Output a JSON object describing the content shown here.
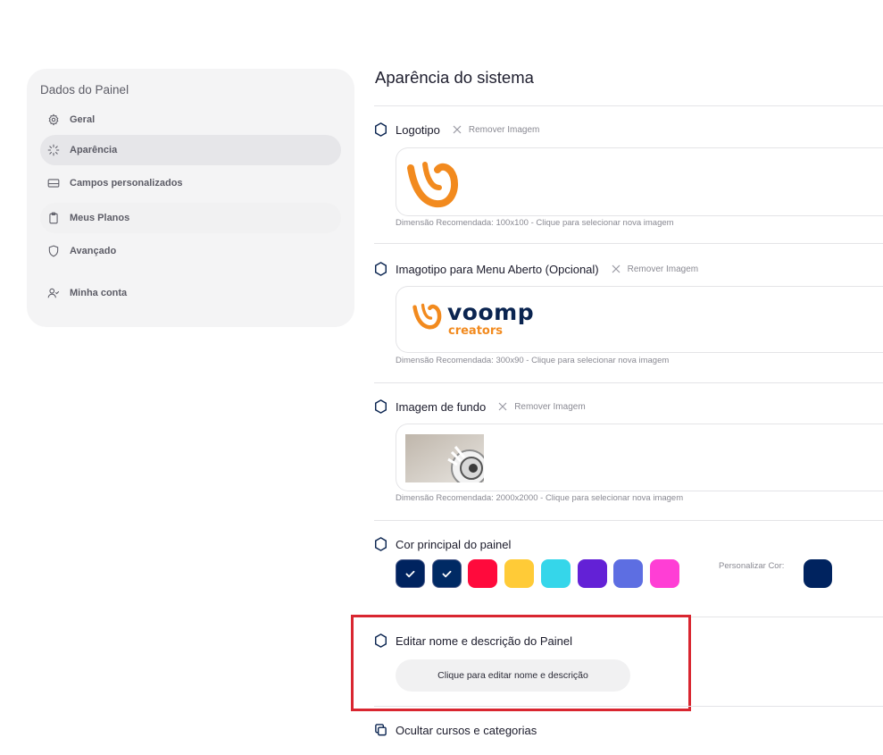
{
  "sidebar": {
    "title": "Dados do Painel",
    "items": [
      {
        "label": "Geral",
        "icon": "gear-icon"
      },
      {
        "label": "Aparência",
        "icon": "loader-icon"
      },
      {
        "label": "Campos personalizados",
        "icon": "card-icon"
      },
      {
        "label": "Meus Planos",
        "icon": "clipboard-icon"
      },
      {
        "label": "Avançado",
        "icon": "shield-icon"
      },
      {
        "label": "Minha conta",
        "icon": "user-check-icon"
      }
    ]
  },
  "main": {
    "title": "Aparência do sistema",
    "remove_label": "Remover Imagem",
    "sections": {
      "logo": {
        "title": "Logotipo",
        "hint": "Dimensão Recomendada: 100x100 - Clique para selecionar nova imagem"
      },
      "imagotipo": {
        "title": "Imagotipo para Menu Aberto (Opcional)",
        "hint": "Dimensão Recomendada: 300x90 - Clique para selecionar nova imagem",
        "brand_word": "voomp",
        "brand_sub": "creators"
      },
      "background": {
        "title": "Imagem de fundo",
        "hint": "Dimensão Recomendada: 2000x2000 - Clique para selecionar nova imagem"
      },
      "color": {
        "title": "Cor principal do painel",
        "custom_label": "Personalizar Cor:",
        "custom_color": "#00235f",
        "swatches": [
          {
            "color": "#00235f",
            "selected": true
          },
          {
            "color": "#002a64",
            "selected": true
          },
          {
            "color": "#ff0a3c",
            "selected": false
          },
          {
            "color": "#ffcb37",
            "selected": false
          },
          {
            "color": "#35d6ea",
            "selected": false
          },
          {
            "color": "#6321d6",
            "selected": false
          },
          {
            "color": "#5d6ee2",
            "selected": false
          },
          {
            "color": "#ff3ed5",
            "selected": false
          }
        ]
      },
      "edit": {
        "title": "Editar nome e descrição do Painel",
        "button": "Clique para editar nome e descrição"
      },
      "hide": {
        "title": "Ocultar cursos e categorias"
      }
    }
  },
  "colors": {
    "accent": "#f28a1e",
    "navy": "#0a2450",
    "highlight": "#d92630"
  }
}
